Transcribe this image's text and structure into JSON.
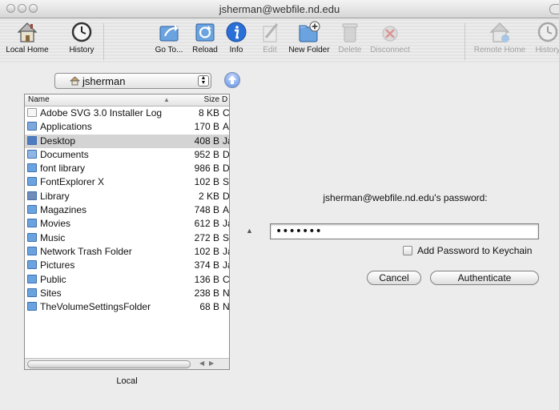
{
  "window": {
    "title": "jsherman@webfile.nd.edu"
  },
  "toolbar": {
    "local_home": "Local Home",
    "history": "History",
    "goto": "Go To...",
    "reload": "Reload",
    "info": "Info",
    "edit": "Edit",
    "new_folder": "New Folder",
    "delete": "Delete",
    "disconnect": "Disconnect",
    "remote_home": "Remote Home",
    "history_remote": "History"
  },
  "browser": {
    "location": "jsherman",
    "columns": {
      "name": "Name",
      "size": "Size",
      "date": "D"
    },
    "items": [
      {
        "name": "Adobe SVG 3.0 Installer Log",
        "size": "8 KB",
        "date": "C",
        "icon": "document-icon",
        "selected": false
      },
      {
        "name": "Applications",
        "size": "170 B",
        "date": "A",
        "icon": "applications-folder-icon",
        "selected": false
      },
      {
        "name": "Desktop",
        "size": "408 B",
        "date": "Ja",
        "icon": "desktop-folder-icon",
        "selected": true
      },
      {
        "name": "Documents",
        "size": "952 B",
        "date": "D",
        "icon": "documents-folder-icon",
        "selected": false
      },
      {
        "name": "font library",
        "size": "986 B",
        "date": "D",
        "icon": "folder-icon",
        "selected": false
      },
      {
        "name": "FontExplorer X",
        "size": "102 B",
        "date": "S",
        "icon": "folder-icon",
        "selected": false
      },
      {
        "name": "Library",
        "size": "2 KB",
        "date": "D",
        "icon": "library-folder-icon",
        "selected": false
      },
      {
        "name": "Magazines",
        "size": "748 B",
        "date": "A",
        "icon": "folder-icon",
        "selected": false
      },
      {
        "name": "Movies",
        "size": "612 B",
        "date": "Ja",
        "icon": "movies-folder-icon",
        "selected": false
      },
      {
        "name": "Music",
        "size": "272 B",
        "date": "S",
        "icon": "music-folder-icon",
        "selected": false
      },
      {
        "name": "Network Trash Folder",
        "size": "102 B",
        "date": "Ja",
        "icon": "folder-icon",
        "selected": false
      },
      {
        "name": "Pictures",
        "size": "374 B",
        "date": "Ja",
        "icon": "pictures-folder-icon",
        "selected": false
      },
      {
        "name": "Public",
        "size": "136 B",
        "date": "C",
        "icon": "public-folder-icon",
        "selected": false
      },
      {
        "name": "Sites",
        "size": "238 B",
        "date": "N",
        "icon": "sites-folder-icon",
        "selected": false
      },
      {
        "name": "TheVolumeSettingsFolder",
        "size": "68 B",
        "date": "N",
        "icon": "folder-icon",
        "selected": false
      }
    ],
    "footer_label": "Local"
  },
  "auth": {
    "prompt": "jsherman@webfile.nd.edu's password:",
    "password_value": "•••••••",
    "keychain_label": "Add Password to Keychain",
    "cancel_label": "Cancel",
    "authenticate_label": "Authenticate"
  },
  "colors": {
    "folder": "#6aa3df",
    "selection": "#d4d4d4",
    "info_blue": "#2a6fd6"
  }
}
